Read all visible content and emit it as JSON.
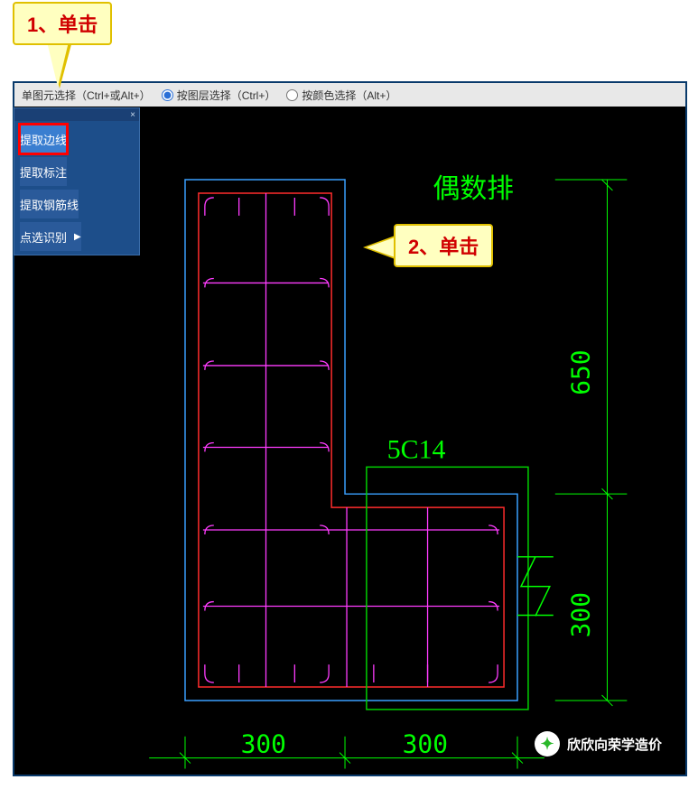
{
  "toolbar": {
    "mode_label": "单图元选择（Ctrl+或Alt+）",
    "opt_layer": "按图层选择（Ctrl+）",
    "opt_color": "按颜色选择（Alt+）"
  },
  "panel": {
    "extract_edge": "提取边线",
    "extract_annotation": "提取标注",
    "extract_rebar": "提取钢筋线",
    "point_recognize": "点选识别"
  },
  "callouts": {
    "c1": "1、单击",
    "c2": "2、单击"
  },
  "drawing": {
    "label_top": "偶数排",
    "label_rebar": "5C14",
    "dim_v1": "650",
    "dim_v2": "300",
    "dim_h1": "300",
    "dim_h2": "300"
  },
  "watermark": "欣欣向荣学造价"
}
